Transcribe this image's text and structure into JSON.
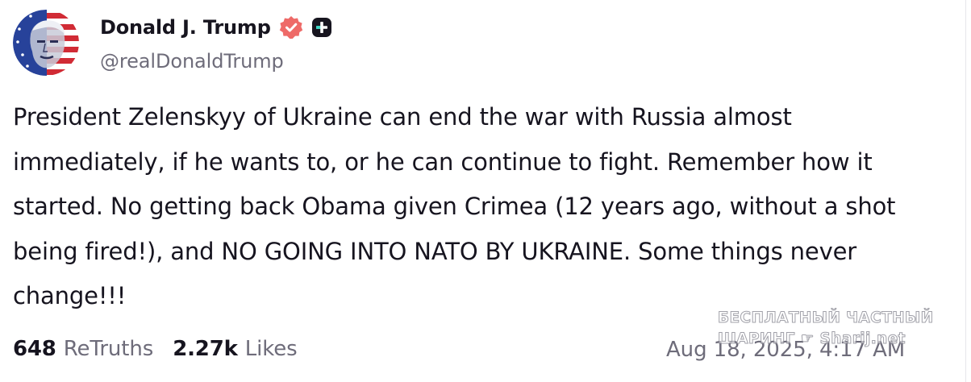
{
  "author": {
    "display_name": "Donald J. Trump",
    "handle": "@realDonaldTrump",
    "avatar_icon": "avatar-flag-portrait",
    "verified_icon": "verified-badge-icon",
    "plus_icon": "truth-plus-icon",
    "verified_color": "#ee6a68"
  },
  "post": {
    "text": "President Zelenskyy of Ukraine can end the war with Russia almost immediately, if he wants to, or he can continue to fight. Remember how it started. No getting back Obama given Crimea (12 years ago, without a shot being fired!), and NO GOING INTO NATO BY UKRAINE. Some things never change!!!"
  },
  "stats": {
    "retruths_count": "648",
    "retruths_label": "ReTruths",
    "likes_count": "2.27k",
    "likes_label": "Likes"
  },
  "timestamp": "Aug 18, 2025, 4:17 AM",
  "watermark": {
    "line1": "БЕСПЛАТНЫЙ ЧАСТНЫЙ",
    "line2": "ШАРИНГ ☛ Sharij.net"
  }
}
